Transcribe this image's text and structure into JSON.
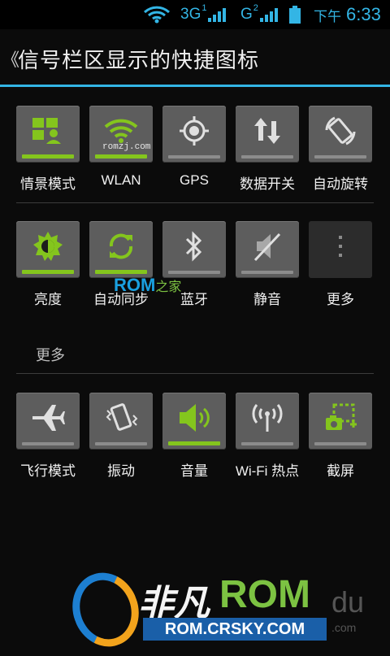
{
  "status_bar": {
    "network_1": "3G",
    "network_1_sim": "1",
    "network_2": "G",
    "network_2_sim": "2",
    "ampm": "下午",
    "time": "6:33",
    "accent_color": "#33b5e5"
  },
  "title_bar": {
    "back_glyph": "《",
    "title": "信号栏区显示的快捷图标"
  },
  "rows": [
    [
      {
        "label": "情景模式",
        "icon": "profile-icon",
        "active": true
      },
      {
        "label": "WLAN",
        "icon": "wifi-icon",
        "active": true
      },
      {
        "label": "GPS",
        "icon": "gps-icon",
        "active": false
      },
      {
        "label": "数据开关",
        "icon": "data-icon",
        "active": false
      },
      {
        "label": "自动旋转",
        "icon": "rotate-icon",
        "active": false
      }
    ],
    [
      {
        "label": "亮度",
        "icon": "brightness-icon",
        "active": true
      },
      {
        "label": "自动同步",
        "icon": "sync-icon",
        "active": true
      },
      {
        "label": "蓝牙",
        "icon": "bluetooth-icon",
        "active": false
      },
      {
        "label": "静音",
        "icon": "mute-icon",
        "active": false
      },
      {
        "label": "更多",
        "icon": "more-icon",
        "active": false
      }
    ],
    [
      {
        "label": "飞行模式",
        "icon": "airplane-icon",
        "active": false
      },
      {
        "label": "振动",
        "icon": "vibrate-icon",
        "active": false
      },
      {
        "label": "音量",
        "icon": "volume-icon",
        "active": true
      },
      {
        "label": "Wi-Fi 热点",
        "icon": "hotspot-icon",
        "active": false
      },
      {
        "label": "截屏",
        "icon": "screenshot-icon",
        "active": false
      }
    ]
  ],
  "section_header": "更多",
  "watermarks": {
    "small": "romzj.com",
    "rom_brand": "ROM",
    "rom_suffix": "之家",
    "logo_cn": "非凡",
    "logo_rom": "ROM",
    "logo_url": "ROM.CRSKY.COM",
    "logo_du": "du",
    "logo_com": ".com"
  },
  "colors": {
    "active": "#84c51d",
    "inactive_bar": "#8c8c8c",
    "tile": "#5d5d5d"
  }
}
